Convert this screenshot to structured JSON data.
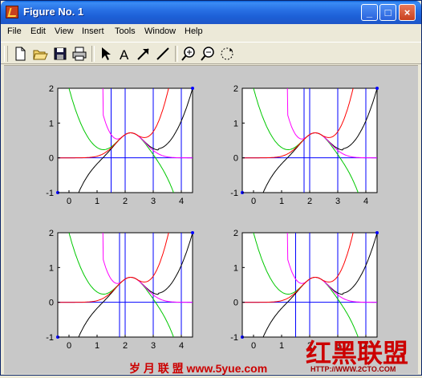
{
  "window": {
    "title": "Figure No. 1",
    "controls": [
      "minimize",
      "maximize",
      "close"
    ]
  },
  "menu": {
    "items": [
      "File",
      "Edit",
      "View",
      "Insert",
      "Tools",
      "Window",
      "Help"
    ]
  },
  "toolbar": {
    "tools": [
      "new-figure-icon",
      "open-file-icon",
      "save-icon",
      "print-icon",
      "select-arrow-icon",
      "insert-text-icon",
      "insert-arrow-icon",
      "insert-line-icon",
      "zoom-in-icon",
      "zoom-out-icon",
      "rotate-3d-icon"
    ]
  },
  "plots": {
    "x_ticks": [
      "0",
      "1",
      "2",
      "3",
      "4"
    ],
    "y_ticks": [
      "2",
      "1",
      "0",
      "-1"
    ],
    "panels": [
      {
        "id": "top-left",
        "vlines": [
          1.5,
          2.0,
          3.0,
          4.0
        ]
      },
      {
        "id": "top-right",
        "vlines": [
          1.8,
          2.0,
          3.0,
          4.0
        ]
      },
      {
        "id": "bottom-left",
        "vlines": [
          1.8,
          2.0,
          3.0,
          4.0
        ]
      },
      {
        "id": "bottom-right",
        "vlines": [
          1.5,
          2.0,
          3.0,
          4.0
        ]
      }
    ]
  },
  "watermark": {
    "left_text": "岁 月 联 盟  www.5yue.com",
    "right_text": "红黑联盟",
    "right_sub": "HTTP://WWW.2CTO.COM"
  },
  "colors": {
    "axes_line": "#0000ff",
    "curve_main": "#000000",
    "curve_green": "#00c800",
    "curve_magenta": "#ff00ff",
    "curve_red": "#ff0000",
    "watermark": "#cc0000"
  }
}
